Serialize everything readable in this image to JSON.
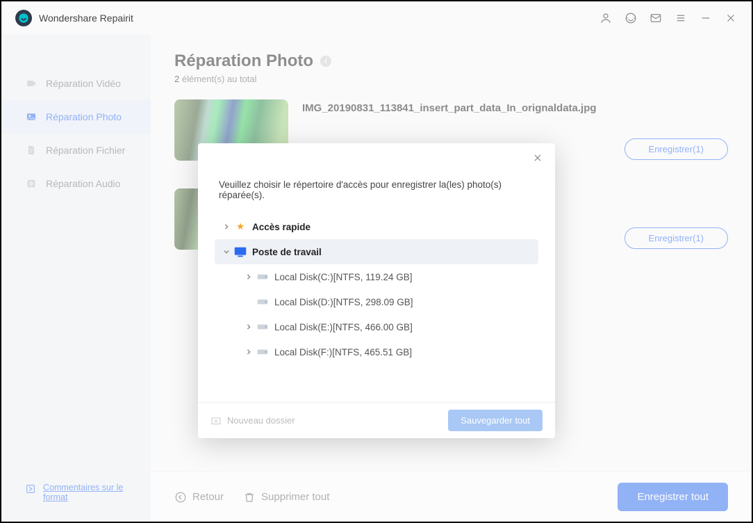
{
  "app_title": "Wondershare Repairit",
  "sidebar": {
    "items": [
      {
        "label": "Réparation Vidéo"
      },
      {
        "label": "Réparation Photo"
      },
      {
        "label": "Réparation Fichier"
      },
      {
        "label": "Réparation Audio"
      }
    ],
    "feedback_label": "Commentaires sur le format"
  },
  "page": {
    "title": "Réparation Photo",
    "count": "2",
    "count_suffix": "élément(s) au total"
  },
  "items": [
    {
      "filename": "IMG_20190831_113841_insert_part_data_In_orignaldata.jpg",
      "action": "Enregistrer(1)"
    },
    {
      "filename": "",
      "action": "Enregistrer(1)"
    }
  ],
  "bottombar": {
    "back": "Retour",
    "delete_all": "Supprimer tout",
    "save_all": "Enregistrer tout"
  },
  "dialog": {
    "message": "Veuillez choisir le répertoire d'accès pour enregistrer la(les) photo(s) réparée(s).",
    "quick_access": "Accès rapide",
    "this_pc": "Poste de travail",
    "disks": [
      "Local Disk(C:)[NTFS, 119.24  GB]",
      "Local Disk(D:)[NTFS, 298.09  GB]",
      "Local Disk(E:)[NTFS, 466.00  GB]",
      "Local Disk(F:)[NTFS, 465.51  GB]"
    ],
    "new_folder": "Nouveau dossier",
    "save_all": "Sauvegarder tout"
  }
}
